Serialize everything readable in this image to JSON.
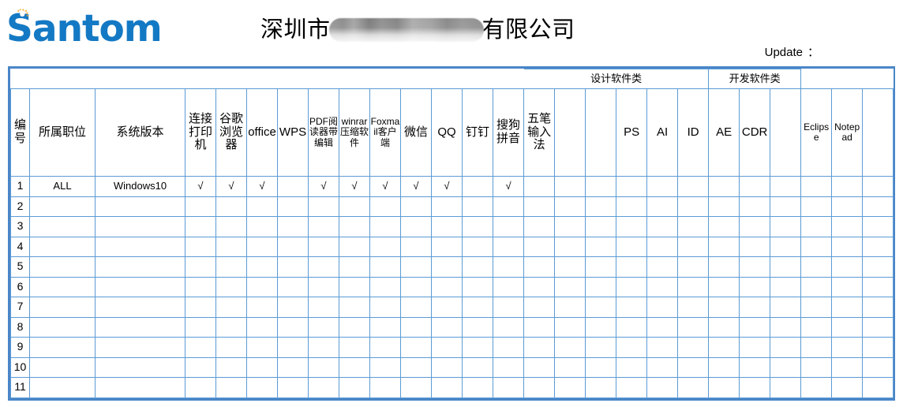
{
  "brand": {
    "logo_text": "Santom",
    "logo_icon": "sun-burst-icon",
    "logo_color": "#1479C4",
    "logo_accent_color": "#F5A623"
  },
  "header": {
    "title_prefix": "深圳市",
    "title_redacted": "",
    "title_suffix": "有限公司",
    "update_label": "Update",
    "update_separator": "：",
    "update_value": ""
  },
  "table": {
    "group_bands": [
      {
        "label": "",
        "span": 14
      },
      {
        "label": "设计软件类",
        "span": 6
      },
      {
        "label": "开发软件类",
        "span": 3
      }
    ],
    "columns": [
      {
        "key": "num",
        "label": "编号",
        "type": "index"
      },
      {
        "key": "pos",
        "label": "所属职位",
        "type": "text"
      },
      {
        "key": "os",
        "label": "系统版本",
        "type": "text"
      },
      {
        "key": "printer",
        "label": "连接打印机",
        "type": "check"
      },
      {
        "key": "chrome",
        "label": "谷歌浏览器",
        "type": "check"
      },
      {
        "key": "office",
        "label": "office",
        "type": "check"
      },
      {
        "key": "wps",
        "label": "WPS",
        "type": "check"
      },
      {
        "key": "pdf",
        "label": "PDF阅读器带编辑",
        "type": "check"
      },
      {
        "key": "winrar",
        "label": "winrar压缩软件",
        "type": "check"
      },
      {
        "key": "foxmail",
        "label": "Foxmail客户端",
        "type": "check"
      },
      {
        "key": "wechat",
        "label": "微信",
        "type": "check"
      },
      {
        "key": "qq",
        "label": "QQ",
        "type": "check"
      },
      {
        "key": "dingtalk",
        "label": "钉钉",
        "type": "check"
      },
      {
        "key": "sogou",
        "label": "搜狗拼音",
        "type": "check"
      },
      {
        "key": "wubi",
        "label": "五笔输入法",
        "type": "check"
      },
      {
        "key": "spare1",
        "label": "",
        "type": "check"
      },
      {
        "key": "spare2",
        "label": "",
        "type": "check"
      },
      {
        "key": "ps",
        "label": "PS",
        "type": "check"
      },
      {
        "key": "ai",
        "label": "AI",
        "type": "check"
      },
      {
        "key": "id",
        "label": "ID",
        "type": "check"
      },
      {
        "key": "ae",
        "label": "AE",
        "type": "check"
      },
      {
        "key": "cdr",
        "label": "CDR",
        "type": "check"
      },
      {
        "key": "spare3",
        "label": "",
        "type": "check"
      },
      {
        "key": "eclipse",
        "label": "Eclipse",
        "type": "check"
      },
      {
        "key": "notepad",
        "label": "Notepad",
        "type": "check"
      },
      {
        "key": "spare4",
        "label": "",
        "type": "check"
      }
    ],
    "check_mark": "√",
    "rows": [
      {
        "num": "1",
        "pos": "ALL",
        "os": "Windows10",
        "checks": {
          "printer": true,
          "chrome": true,
          "office": true,
          "wps": false,
          "pdf": true,
          "winrar": true,
          "foxmail": true,
          "wechat": true,
          "qq": true,
          "dingtalk": false,
          "sogou": true,
          "wubi": false,
          "spare1": false,
          "spare2": false,
          "ps": false,
          "ai": false,
          "id": false,
          "ae": false,
          "cdr": false,
          "spare3": false,
          "eclipse": false,
          "notepad": false,
          "spare4": false
        }
      },
      {
        "num": "2",
        "pos": "",
        "os": "",
        "checks": {}
      },
      {
        "num": "3",
        "pos": "",
        "os": "",
        "checks": {}
      },
      {
        "num": "4",
        "pos": "",
        "os": "",
        "checks": {}
      },
      {
        "num": "5",
        "pos": "",
        "os": "",
        "checks": {}
      },
      {
        "num": "6",
        "pos": "",
        "os": "",
        "checks": {}
      },
      {
        "num": "7",
        "pos": "",
        "os": "",
        "checks": {}
      },
      {
        "num": "8",
        "pos": "",
        "os": "",
        "checks": {}
      },
      {
        "num": "9",
        "pos": "",
        "os": "",
        "checks": {}
      },
      {
        "num": "10",
        "pos": "",
        "os": "",
        "checks": {}
      },
      {
        "num": "11",
        "pos": "",
        "os": "",
        "checks": {}
      }
    ]
  },
  "colors": {
    "grid_line": "#5B9BD5",
    "outer_border": "#4A86C8",
    "text": "#000000"
  }
}
